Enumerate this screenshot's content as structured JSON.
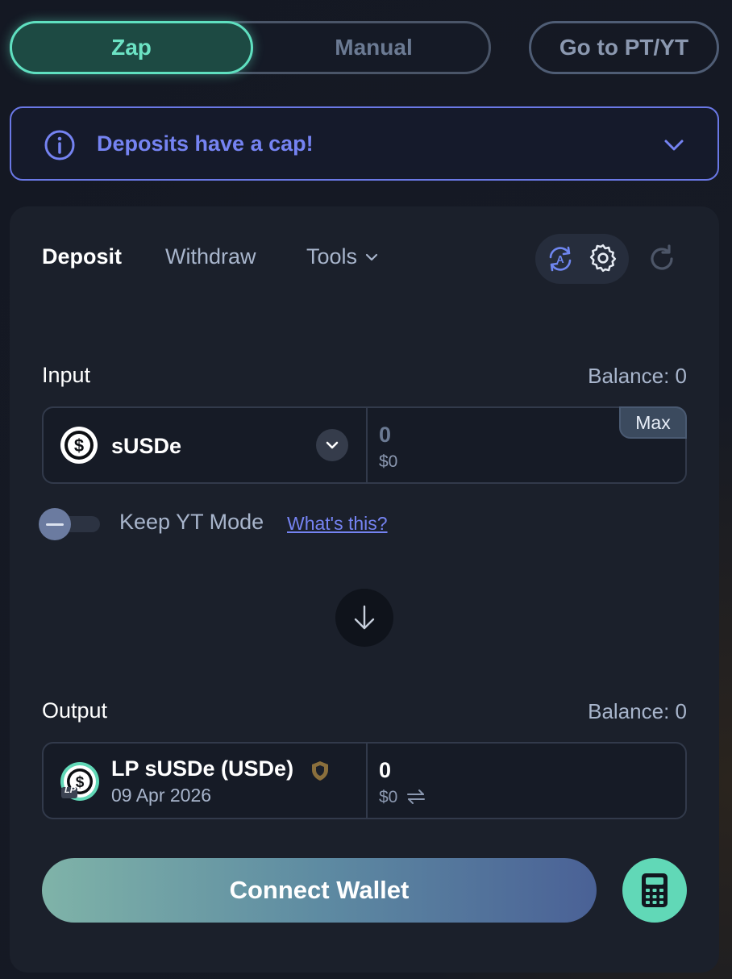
{
  "mode_switch": {
    "zap_label": "Zap",
    "manual_label": "Manual",
    "active": "Zap"
  },
  "goto_label": "Go to PT/YT",
  "banner": {
    "text": "Deposits have a cap!"
  },
  "tabs": {
    "deposit": "Deposit",
    "withdraw": "Withdraw",
    "tools": "Tools",
    "active": "Deposit"
  },
  "input": {
    "label": "Input",
    "balance": "Balance: 0",
    "token": "sUSDe",
    "amount": "0",
    "usd": "$0",
    "max_label": "Max"
  },
  "keep_yt": {
    "label": "Keep YT Mode",
    "help_link": "What's this?",
    "enabled": false
  },
  "output": {
    "label": "Output",
    "balance": "Balance: 0",
    "token": "LP sUSDe (USDe)",
    "date": "09 Apr 2026",
    "lp_badge": "LP",
    "amount": "0",
    "usd": "$0"
  },
  "connect_wallet": "Connect Wallet",
  "colors": {
    "accent_teal": "#5fe0c0",
    "accent_blue": "#6a78e6",
    "card_bg": "#1b202b"
  },
  "icons": {
    "banner": "info-icon",
    "banner_toggle": "chevron-down-icon",
    "auto": "auto-swap-icon",
    "settings": "gear-icon",
    "refresh": "refresh-icon",
    "flow": "arrow-down-icon",
    "verified": "shield-icon",
    "swap": "swap-arrows-icon",
    "calculator": "calculator-icon"
  }
}
